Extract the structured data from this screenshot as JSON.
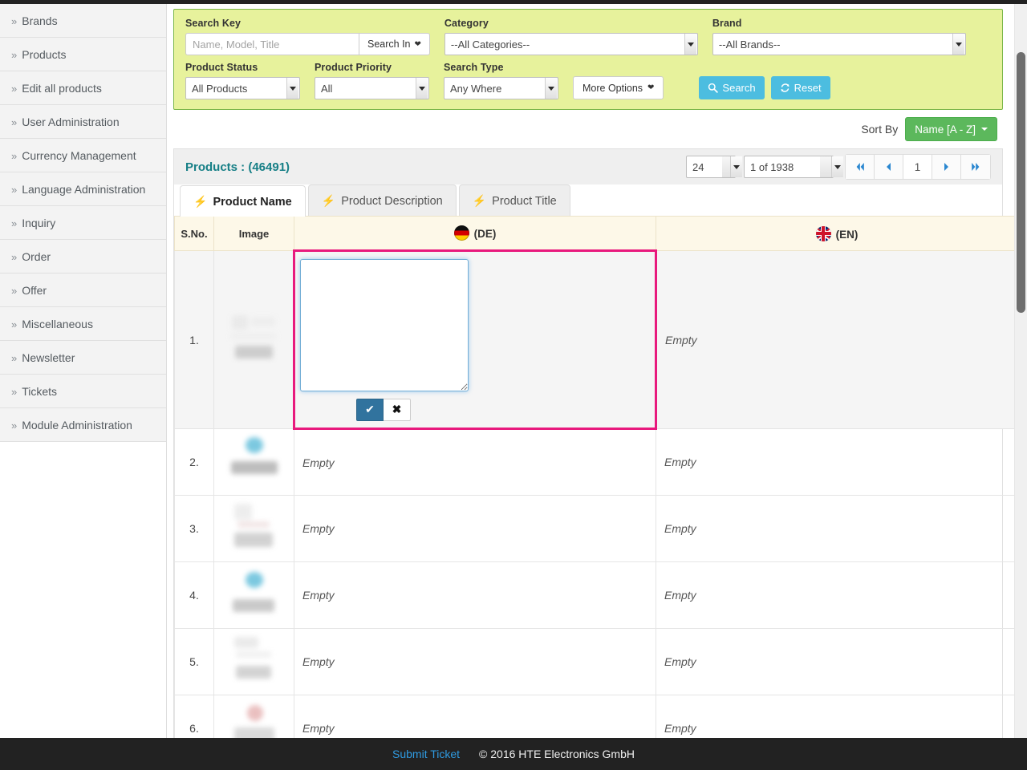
{
  "sidebar": {
    "prefix": "»",
    "items": [
      {
        "label": "Brands"
      },
      {
        "label": "Products"
      },
      {
        "label": "Edit all products"
      },
      {
        "label": "User Administration"
      },
      {
        "label": "Currency Management"
      },
      {
        "label": "Language Administration"
      },
      {
        "label": "Inquiry"
      },
      {
        "label": "Order"
      },
      {
        "label": "Offer"
      },
      {
        "label": "Miscellaneous"
      },
      {
        "label": "Newsletter"
      },
      {
        "label": "Tickets"
      },
      {
        "label": "Module Administration"
      }
    ]
  },
  "search_panel": {
    "search_key": {
      "label": "Search Key",
      "placeholder": "Name, Model, Title",
      "value": "",
      "search_in_label": "Search In"
    },
    "category": {
      "label": "Category",
      "value": "--All Categories--"
    },
    "brand": {
      "label": "Brand",
      "value": "--All Brands--"
    },
    "product_status": {
      "label": "Product Status",
      "value": "All Products"
    },
    "product_priority": {
      "label": "Product Priority",
      "value": "All"
    },
    "search_type": {
      "label": "Search Type",
      "value": "Any Where"
    },
    "more_options_label": "More Options",
    "search_button": "Search",
    "reset_button": "Reset",
    "accent_bg": "#e7f29c",
    "accent_border": "#7ab648",
    "button_color": "#4cbde0"
  },
  "sort": {
    "label": "Sort By",
    "value": "Name [A - Z]",
    "color": "#5cb85c"
  },
  "products_bar": {
    "title": "Products : (46491)",
    "per_page": "24",
    "page_of": "1 of 1938",
    "pager": {
      "first": "«",
      "prev": "‹",
      "current": "1",
      "next": "›",
      "last": "»"
    }
  },
  "tabs": [
    {
      "label": "Product Name",
      "active": true
    },
    {
      "label": "Product Description",
      "active": false
    },
    {
      "label": "Product Title",
      "active": false
    }
  ],
  "table": {
    "headers": {
      "sno": "S.No.",
      "image": "Image",
      "de": "(DE)",
      "en": "(EN)"
    },
    "rows": [
      {
        "sno": "1.",
        "de": "",
        "en": "Empty",
        "editing": true
      },
      {
        "sno": "2.",
        "de": "Empty",
        "en": "Empty",
        "editing": false
      },
      {
        "sno": "3.",
        "de": "Empty",
        "en": "Empty",
        "editing": false
      },
      {
        "sno": "4.",
        "de": "Empty",
        "en": "Empty",
        "editing": false
      },
      {
        "sno": "5.",
        "de": "Empty",
        "en": "Empty",
        "editing": false
      },
      {
        "sno": "6.",
        "de": "Empty",
        "en": "Empty",
        "editing": false
      }
    ],
    "editor": {
      "value": "",
      "confirm_label": "✔",
      "cancel_label": "✖"
    },
    "highlight_color": "#e8197d"
  },
  "footer": {
    "link": "Submit Ticket",
    "copyright": "© 2016 HTE Electronics GmbH"
  }
}
